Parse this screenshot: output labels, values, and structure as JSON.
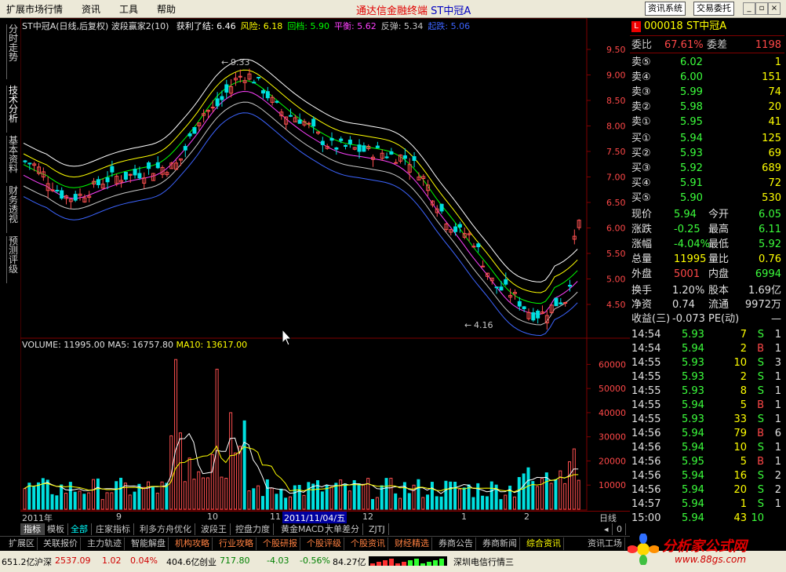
{
  "menubar": {
    "items": [
      "扩展市场行情",
      "资讯",
      "工具",
      "帮助"
    ],
    "app_title": "通达信金融终端",
    "stock_tag": "ST中冠A",
    "btn_info": "资讯系统",
    "btn_trade": "交易委托"
  },
  "left_tabs": [
    "分时走势",
    "技术分析",
    "基本资料",
    "财务透视",
    "预测评级"
  ],
  "chart_header": {
    "name": "ST中冠A(日线,后复权)",
    "indicator": "波段赢家2(10)",
    "items": [
      {
        "label": "获利了结:",
        "value": "6.46",
        "color": "#ffffff"
      },
      {
        "label": "风险:",
        "value": "6.18",
        "color": "#ffff00"
      },
      {
        "label": "回档:",
        "value": "5.90",
        "color": "#00ff00"
      },
      {
        "label": "平衡:",
        "value": "5.62",
        "color": "#ff40ff"
      },
      {
        "label": "反弹:",
        "value": "5.34",
        "color": "#c8c8c8"
      },
      {
        "label": "起跌:",
        "value": "5.06",
        "color": "#3c64ff"
      }
    ]
  },
  "price_axis": [
    "9.50",
    "9.00",
    "8.50",
    "8.00",
    "7.50",
    "7.00",
    "6.50",
    "6.00",
    "5.50",
    "5.00",
    "4.50"
  ],
  "annotations": {
    "high": "9.33",
    "low": "4.16"
  },
  "volume_header": {
    "volume": "VOLUME: 11995.00",
    "ma5": "MA5: 16757.80",
    "ma10": "MA10: 13617.00"
  },
  "volume_axis": [
    "60000",
    "50000",
    "40000",
    "30000",
    "20000",
    "10000"
  ],
  "date_axis": {
    "labels": [
      "2011年",
      "9",
      "10",
      "11",
      "12",
      "1",
      "2"
    ],
    "cursor_date": "2011/11/04/五",
    "period": "日线"
  },
  "chart_data": {
    "type": "line",
    "title": "ST中冠A(日线,后复权)",
    "series": [
      {
        "name": "获利了结",
        "last": 6.46
      },
      {
        "name": "风险",
        "last": 6.18
      },
      {
        "name": "回档",
        "last": 5.9
      },
      {
        "name": "平衡",
        "last": 5.62
      },
      {
        "name": "反弹",
        "last": 5.34
      },
      {
        "name": "起跌",
        "last": 5.06
      }
    ],
    "ylim": [
      4.2,
      9.7
    ],
    "annotated_high": 9.33,
    "annotated_low": 4.16,
    "volume_ylim": [
      0,
      65000
    ],
    "volume_last": 11995,
    "ma5_last": 16757.8,
    "ma10_last": 13617
  },
  "quote": {
    "code": "000018",
    "name": "ST中冠A",
    "weibi_label": "委比",
    "weibi": "67.61%",
    "weicha_label": "委差",
    "weicha": "1198",
    "sells": [
      {
        "label": "卖⑤",
        "price": "6.02",
        "vol": "1"
      },
      {
        "label": "卖④",
        "price": "6.00",
        "vol": "151"
      },
      {
        "label": "卖③",
        "price": "5.99",
        "vol": "74"
      },
      {
        "label": "卖②",
        "price": "5.98",
        "vol": "20"
      },
      {
        "label": "卖①",
        "price": "5.95",
        "vol": "41"
      }
    ],
    "buys": [
      {
        "label": "买①",
        "price": "5.94",
        "vol": "125"
      },
      {
        "label": "买②",
        "price": "5.93",
        "vol": "69"
      },
      {
        "label": "买③",
        "price": "5.92",
        "vol": "689"
      },
      {
        "label": "买④",
        "price": "5.91",
        "vol": "72"
      },
      {
        "label": "买⑤",
        "price": "5.90",
        "vol": "530"
      }
    ],
    "stats": [
      {
        "l1": "现价",
        "v1": "5.94",
        "c1": "grn",
        "l2": "今开",
        "v2": "6.05",
        "c2": "grn"
      },
      {
        "l1": "涨跌",
        "v1": "-0.25",
        "c1": "grn",
        "l2": "最高",
        "v2": "6.11",
        "c2": "grn"
      },
      {
        "l1": "涨幅",
        "v1": "-4.04%",
        "c1": "grn",
        "l2": "最低",
        "v2": "5.92",
        "c2": "grn"
      },
      {
        "l1": "总量",
        "v1": "11995",
        "c1": "yel",
        "l2": "量比",
        "v2": "0.76",
        "c2": "yel"
      },
      {
        "l1": "外盘",
        "v1": "5001",
        "c1": "red",
        "l2": "内盘",
        "v2": "6994",
        "c2": "grn"
      }
    ],
    "stats2": [
      {
        "l1": "换手",
        "v1": "1.20%",
        "l2": "股本",
        "v2": "1.69亿"
      },
      {
        "l1": "净资",
        "v1": "0.74",
        "l2": "流通",
        "v2": "9972万"
      },
      {
        "l1": "收益(三)",
        "v1": "-0.073",
        "l2": "PE(动)",
        "v2": "—"
      }
    ],
    "ticks": [
      {
        "t": "14:54",
        "p": "5.93",
        "v": "7",
        "s": "S",
        "n": "1"
      },
      {
        "t": "14:54",
        "p": "5.94",
        "v": "2",
        "s": "B",
        "n": "1"
      },
      {
        "t": "14:55",
        "p": "5.93",
        "v": "10",
        "s": "S",
        "n": "3"
      },
      {
        "t": "14:55",
        "p": "5.93",
        "v": "2",
        "s": "S",
        "n": "1"
      },
      {
        "t": "14:55",
        "p": "5.93",
        "v": "8",
        "s": "S",
        "n": "1"
      },
      {
        "t": "14:55",
        "p": "5.94",
        "v": "5",
        "s": "B",
        "n": "1"
      },
      {
        "t": "14:55",
        "p": "5.93",
        "v": "33",
        "s": "S",
        "n": "1"
      },
      {
        "t": "14:56",
        "p": "5.94",
        "v": "79",
        "s": "B",
        "n": "6"
      },
      {
        "t": "14:56",
        "p": "5.94",
        "v": "10",
        "s": "S",
        "n": "1"
      },
      {
        "t": "14:56",
        "p": "5.95",
        "v": "5",
        "s": "B",
        "n": "1"
      },
      {
        "t": "14:56",
        "p": "5.94",
        "v": "16",
        "s": "S",
        "n": "2"
      },
      {
        "t": "14:56",
        "p": "5.94",
        "v": "20",
        "s": "S",
        "n": "2"
      },
      {
        "t": "14:57",
        "p": "5.94",
        "v": "1",
        "s": "S",
        "n": "1"
      },
      {
        "t": "15:00",
        "p": "5.94",
        "v": "43",
        "s": "10",
        "n": ""
      }
    ]
  },
  "indicator_tabs": [
    "指标",
    "模板",
    "全部",
    "庄家指标",
    "利多方舟优化",
    "波段王",
    "控盘力度",
    "黄金MACD",
    "大单差分",
    "ZJTJ"
  ],
  "category_tabs": [
    "扩展区",
    "关联报价",
    "主力轨迹",
    "智能解盘",
    "机构攻略",
    "行业攻略",
    "个股研报",
    "个股评级",
    "个股资讯",
    "财经精选",
    "券商公告",
    "券商新闻",
    "综合资讯",
    "资讯工场"
  ],
  "status_bar": {
    "v1": "651.2亿",
    "sz_label": "沪深",
    "sz_val": "2537.09",
    "sz_chg": "1.02",
    "sz_pct": "0.04%",
    "v2": "404.6亿",
    "cy_label": "创业",
    "cy_val": "717.80",
    "cy_chg": "-4.03",
    "cy_pct": "-0.56%",
    "v3": "84.27亿",
    "server": "深圳电信行情三"
  },
  "watermark": {
    "text": "分析家公式网",
    "url": "www.88gs.com"
  }
}
